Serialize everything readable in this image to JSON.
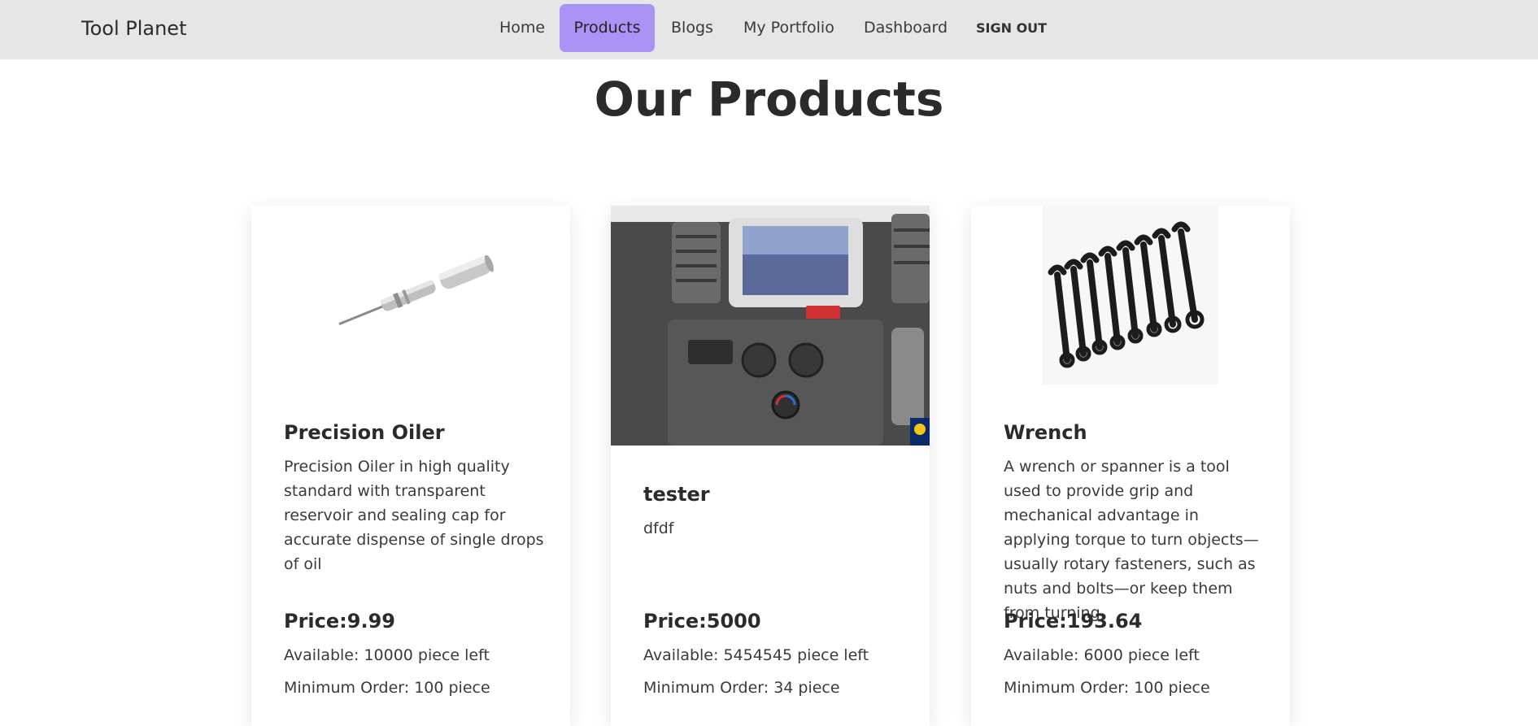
{
  "brand": "Tool Planet",
  "nav": {
    "home": "Home",
    "products": "Products",
    "blogs": "Blogs",
    "portfolio": "My Portfolio",
    "dashboard": "Dashboard",
    "signout": "SIGN OUT"
  },
  "page_title": "Our Products",
  "colors": {
    "nav_bg": "#e6e6e6",
    "active_nav": "#ab93f5"
  },
  "products": [
    {
      "name": "Precision Oiler",
      "description": "Precision Oiler in high quality standard with transparent reservoir and sealing cap for accurate dispense of single drops of oil",
      "price": "Price:9.99",
      "available": "Available: 10000 piece left",
      "min_order": "Minimum Order: 100 piece",
      "image": "precision-oiler-image"
    },
    {
      "name": "tester",
      "description": "dfdf",
      "price": "Price:5000",
      "available": "Available: 5454545 piece left",
      "min_order": "Minimum Order: 34 piece",
      "image": "car-dashboard-photo"
    },
    {
      "name": "Wrench",
      "description": "A wrench or spanner is a tool used to provide grip and mechanical advantage in applying torque to turn objects—usually rotary fasteners, such as nuts and bolts—or keep them from turning",
      "price": "Price:193.64",
      "available": "Available: 6000 piece left",
      "min_order": "Minimum Order: 100 piece",
      "image": "wrench-set-image"
    }
  ]
}
